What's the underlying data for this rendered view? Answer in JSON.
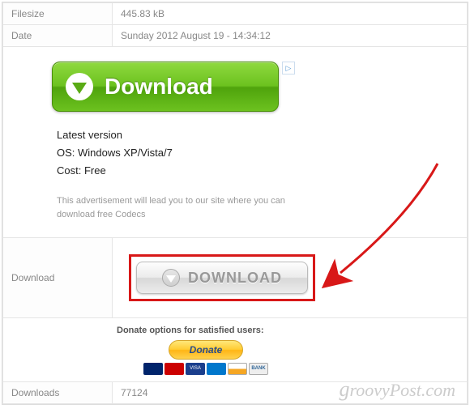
{
  "rows": {
    "filesize": {
      "label": "Filesize",
      "value": "445.83 kB"
    },
    "date": {
      "label": "Date",
      "value": "Sunday 2012 August 19 - 14:34:12"
    },
    "download": {
      "label": "Download"
    },
    "downloads": {
      "label": "Downloads",
      "value": "77124"
    }
  },
  "ad": {
    "button_text": "Download",
    "info_line1": "Latest version",
    "info_line2": "OS: Windows XP/Vista/7",
    "info_line3": "Cost: Free",
    "fineprint": "This advertisement will lead you to our site where you can download free Codecs"
  },
  "download_button": {
    "text": "DOWNLOAD"
  },
  "donate": {
    "label": "Donate options for satisfied users:",
    "button": "Donate",
    "cards": [
      "",
      "",
      "VISA",
      "",
      "",
      "BANK"
    ]
  },
  "watermark": "groovyPost.com"
}
